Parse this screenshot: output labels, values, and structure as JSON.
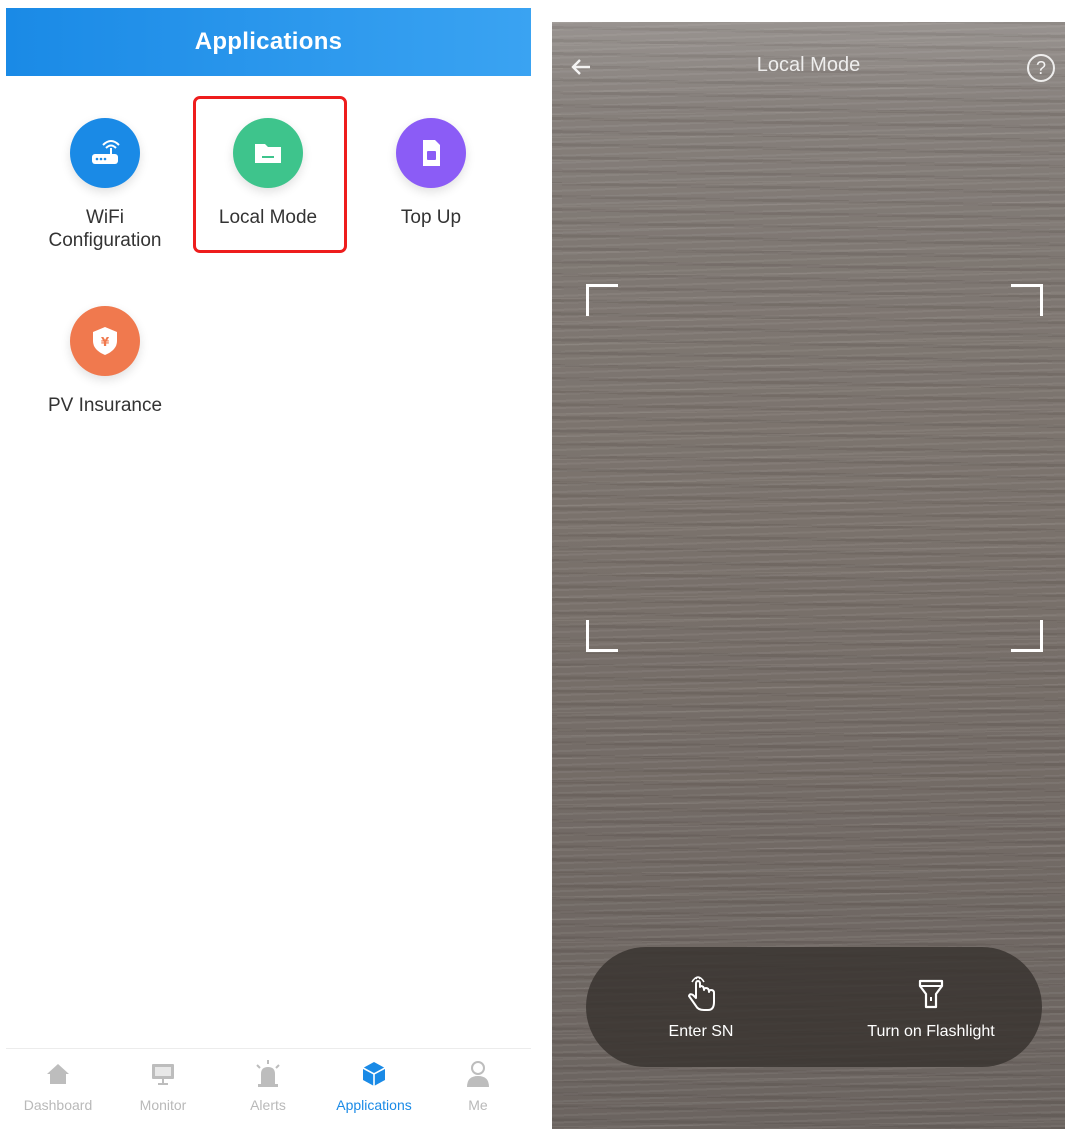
{
  "left": {
    "header": {
      "title": "Applications"
    },
    "apps": [
      {
        "label": "WiFi\nConfiguration",
        "icon": "router-icon",
        "color": "#1a8ae6"
      },
      {
        "label": "Local Mode",
        "icon": "folder-icon",
        "color": "#3ec48c"
      },
      {
        "label": "Top Up",
        "icon": "sim-card-icon",
        "color": "#8b5cf6"
      },
      {
        "label": "PV Insurance",
        "icon": "shield-yen-icon",
        "color": "#f0794e"
      }
    ],
    "highlight_color": "#ee1d1d",
    "tabbar": [
      {
        "label": "Dashboard",
        "icon": "home-icon",
        "active": false
      },
      {
        "label": "Monitor",
        "icon": "monitor-icon",
        "active": false
      },
      {
        "label": "Alerts",
        "icon": "alarm-icon",
        "active": false
      },
      {
        "label": "Applications",
        "icon": "cube-icon",
        "active": true
      },
      {
        "label": "Me",
        "icon": "user-icon",
        "active": false
      }
    ],
    "accent": "#1a8ae6"
  },
  "right": {
    "title": "Local Mode",
    "help_glyph": "?",
    "actions": [
      {
        "label": "Enter SN",
        "icon": "tap-hand-icon"
      },
      {
        "label": "Turn on Flashlight",
        "icon": "flashlight-icon"
      }
    ]
  }
}
